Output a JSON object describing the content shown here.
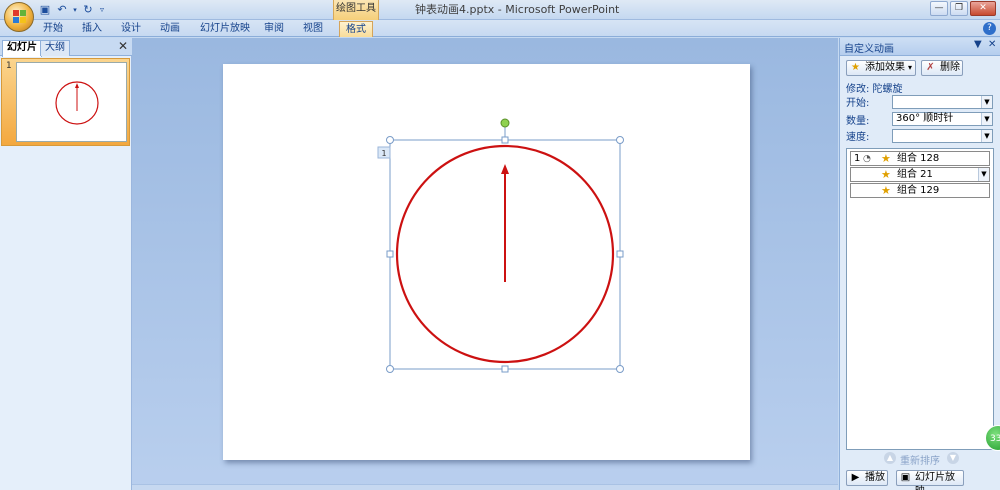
{
  "titlebar": {
    "document_title": "钟表动画4.pptx - Microsoft PowerPoint",
    "context_group": "绘图工具"
  },
  "ribbon": {
    "tabs": [
      "开始",
      "插入",
      "设计",
      "动画",
      "幻灯片放映",
      "审阅",
      "视图"
    ],
    "context_tab": "格式"
  },
  "left_pane": {
    "tabs": [
      "幻灯片",
      "大纲"
    ],
    "active_tab": "幻灯片",
    "slide_number": "1"
  },
  "slide": {
    "animation_tag": "1"
  },
  "task_pane": {
    "title": "自定义动画",
    "add_effect": "添加效果",
    "remove": "删除",
    "modify_label": "修改: 陀螺旋",
    "start_label": "开始:",
    "start_value": "",
    "amount_label": "数量:",
    "amount_value": "360°  顺时针",
    "speed_label": "速度:",
    "speed_value": "",
    "items": [
      {
        "num": "1",
        "label": "组合 128"
      },
      {
        "num": "",
        "label": "组合 21"
      },
      {
        "num": "",
        "label": "组合 129"
      }
    ],
    "reorder_label": "重新排序",
    "play_label": "播放",
    "slideshow_label": "幻灯片放映"
  },
  "badge": "33",
  "colors": {
    "accent": "#15428b",
    "circle": "#cc1111",
    "selected_slide": "#f3a83f"
  }
}
